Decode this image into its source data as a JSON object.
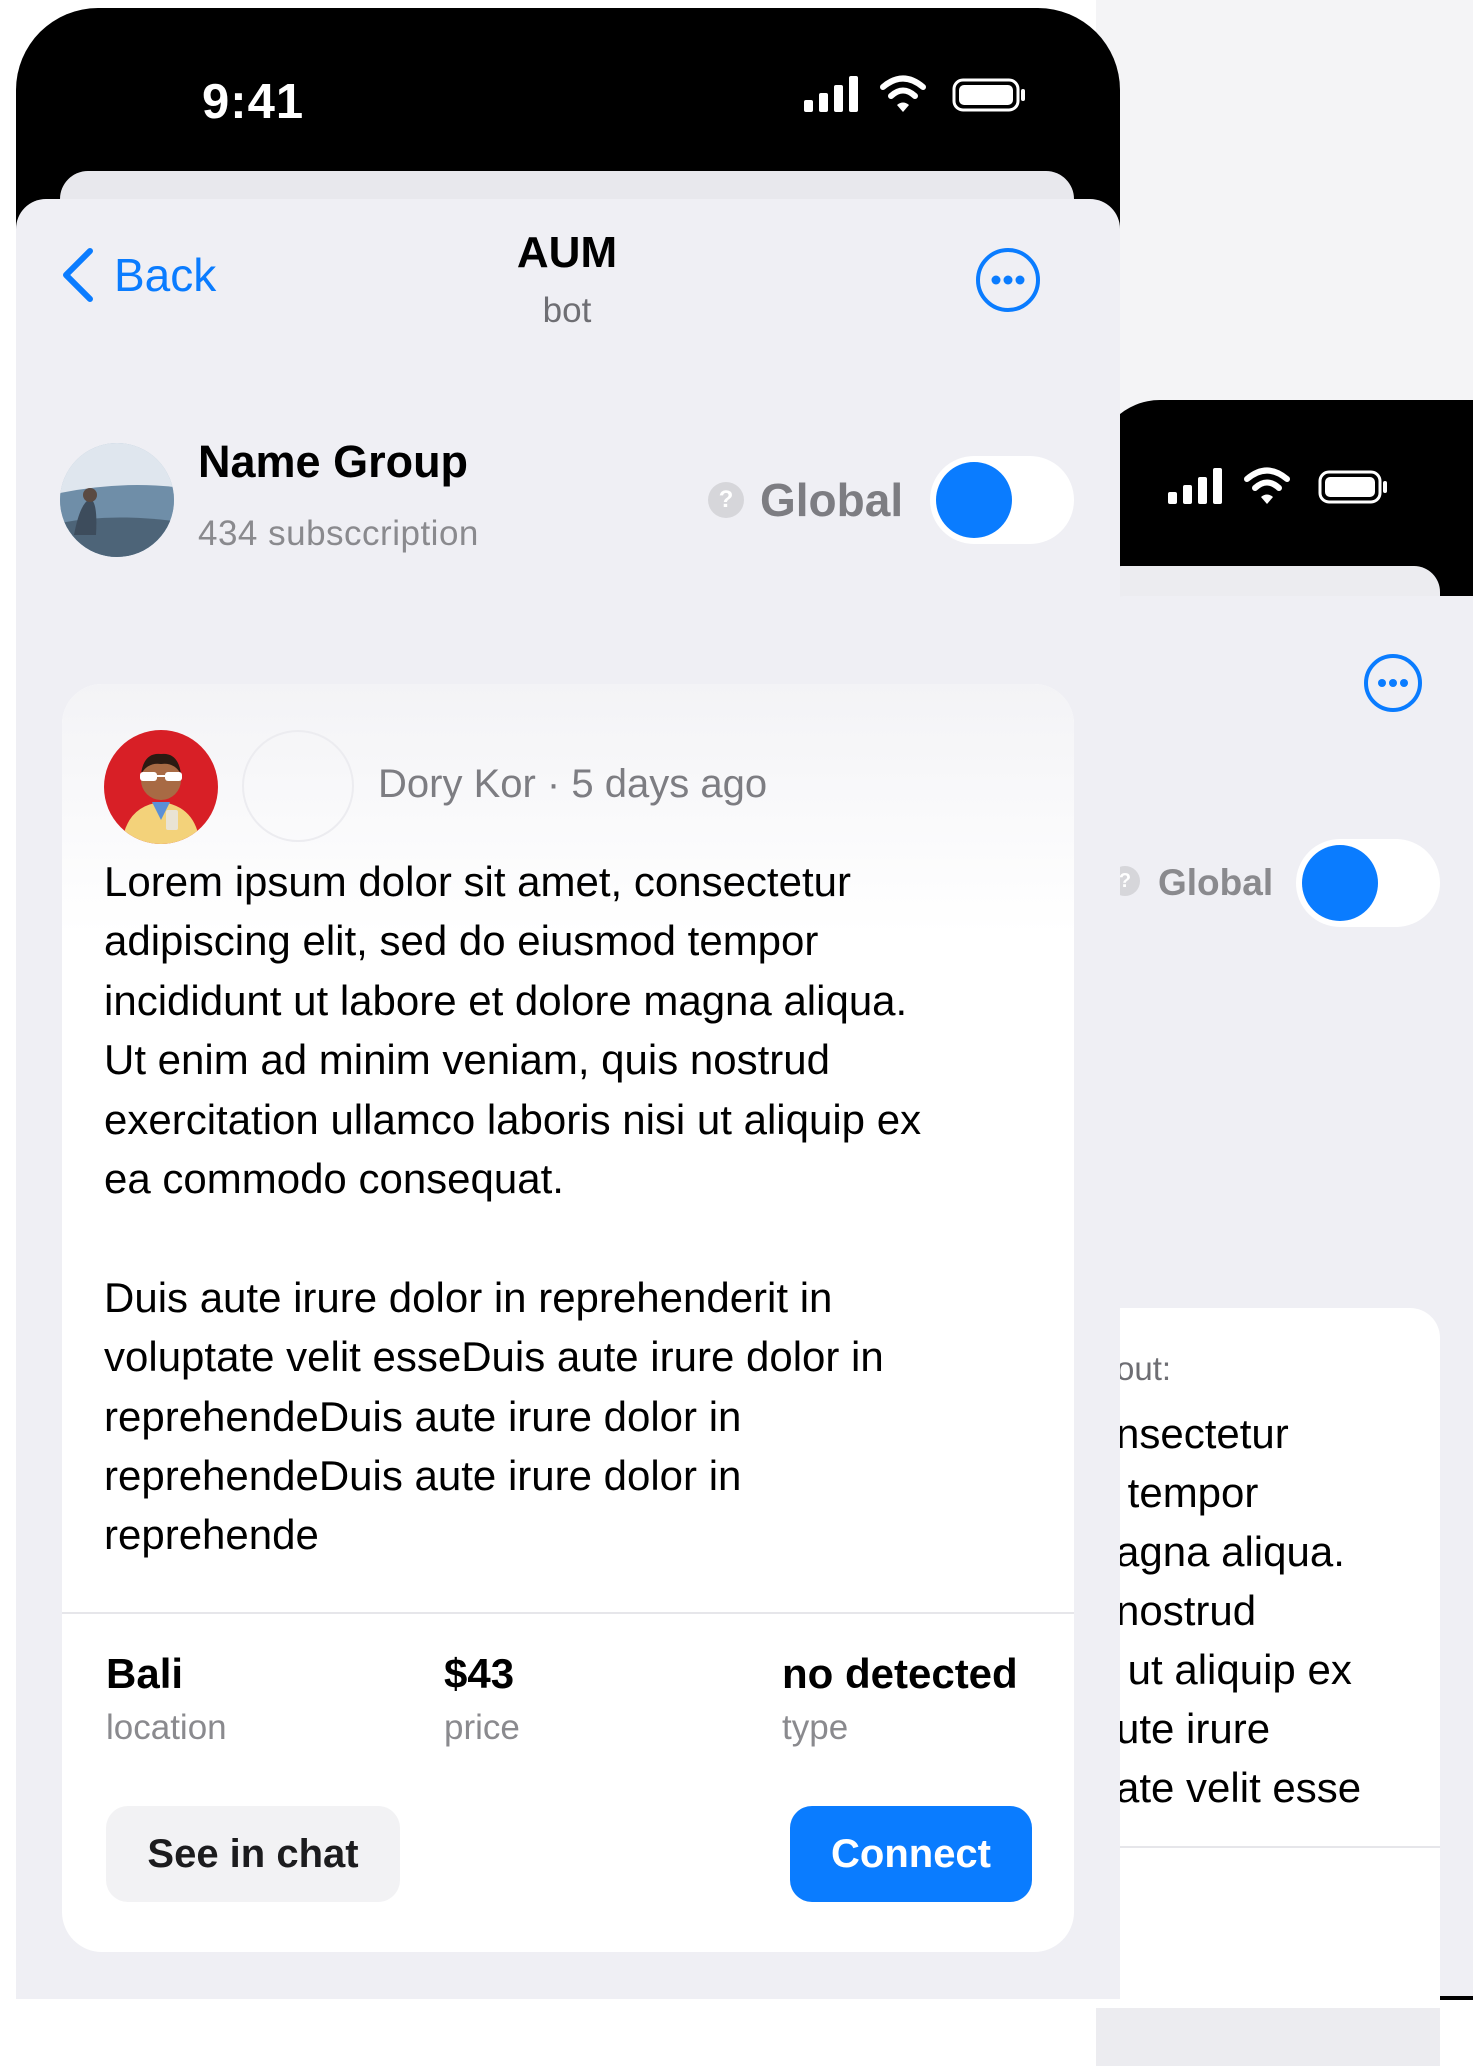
{
  "status_bar": {
    "time": "9:41"
  },
  "nav": {
    "back_label": "Back",
    "title": "AUM",
    "subtitle": "bot"
  },
  "group": {
    "name": "Name Group",
    "subscriptions": "434 subsccription",
    "help_glyph": "?",
    "toggle_label": "Global",
    "toggle_on": true
  },
  "post": {
    "author_line": "Dory Kor · 5 days ago",
    "body": "Lorem ipsum dolor sit amet, consectetur\nadipiscing elit, sed do eiusmod tempor\nincididunt ut labore et dolore magna aliqua.\nUt enim ad minim veniam, quis nostrud\nexercitation ullamco laboris nisi ut aliquip ex\nea commodo consequat.\n\nDuis aute irure dolor in reprehenderit in\nvoluptate velit esseDuis aute irure dolor in\nreprehendeDuis aute irure dolor in\nreprehendeDuis aute irure dolor in\nreprehende",
    "stats": [
      {
        "value": "Bali",
        "label": "location"
      },
      {
        "value": "$43",
        "label": "price"
      },
      {
        "value": "no detected",
        "label": "type"
      }
    ],
    "see_in_chat": "See in chat",
    "connect": "Connect"
  },
  "background_screen": {
    "help_glyph": "?",
    "toggle_label": "Global",
    "toggle_on": true,
    "card_label": "out:",
    "card_text": "nsectetur\n tempor\nagna aliqua.\nnostrud\n ut aliquip ex\nute irure\nate velit esse"
  },
  "colors": {
    "accent": "#0a7cff",
    "background": "#efeff4",
    "card": "#ffffff"
  },
  "icons": [
    "chevron-left-icon",
    "more-horizontal-icon",
    "signal-icon",
    "wifi-icon",
    "battery-icon",
    "help-icon"
  ]
}
